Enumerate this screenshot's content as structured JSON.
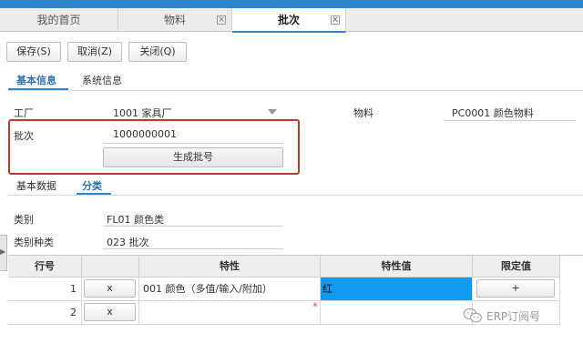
{
  "tabs": {
    "home": "我的首页",
    "material": "物料",
    "batch": "批次",
    "close_glyph": "×"
  },
  "toolbar": {
    "save": "保存(S)",
    "cancel": "取消(Z)",
    "close": "关闭(Q)"
  },
  "info_tabs": {
    "basic": "基本信息",
    "system": "系统信息"
  },
  "form": {
    "plant_label": "工厂",
    "plant_value": "1001 家具厂",
    "material_label": "物料",
    "material_value": "PC0001 颜色物料",
    "batch_label": "批次",
    "batch_value": "1000000001",
    "generate_button": "生成批号"
  },
  "data_tabs": {
    "basic_data": "基本数据",
    "classification": "分类"
  },
  "classification": {
    "class_label": "类别",
    "class_value": "FL01 颜色类",
    "class_type_label": "类别种类",
    "class_type_value": "023 批次"
  },
  "side_handle_glyph": "▶",
  "grid": {
    "headers": [
      "行号",
      "",
      "特性",
      "特性值",
      "限定值"
    ],
    "rows": [
      {
        "line": "1",
        "delete": "x",
        "characteristic": "001 颜色（多值/输入/附加）",
        "value": "红",
        "limit_button": "+"
      },
      {
        "line": "2",
        "delete": "x",
        "characteristic": "",
        "value": "",
        "required_mark": "*"
      }
    ],
    "selected_value_color": "#0e9bf1"
  },
  "watermark": {
    "text": "ERP订阅号",
    "icon": "wechat-icon"
  },
  "colors": {
    "accent": "#2f86c9",
    "highlight_box": "#c0392b"
  }
}
